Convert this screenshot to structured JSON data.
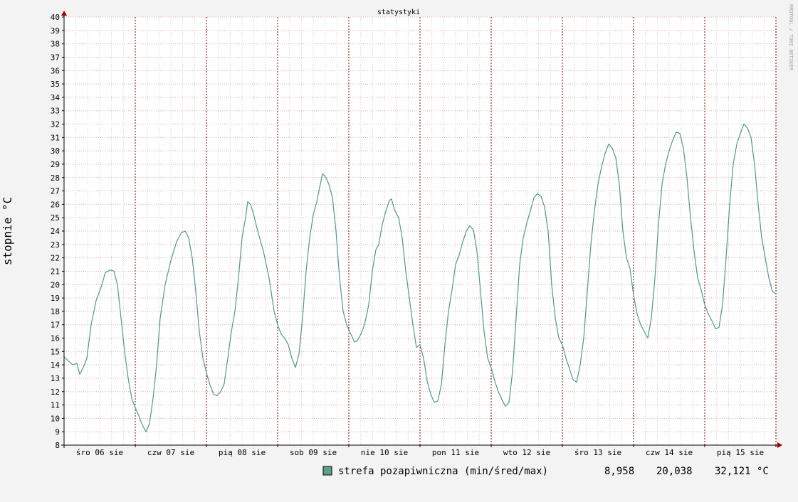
{
  "chart_data": {
    "type": "line",
    "title": "statystyki",
    "ylabel": "stopnie °C",
    "watermark": "RRDTOOL / TOBI OETIKER",
    "ylim": [
      8,
      40
    ],
    "yticks": [
      8,
      9,
      10,
      11,
      12,
      13,
      14,
      15,
      16,
      17,
      18,
      19,
      20,
      21,
      22,
      23,
      24,
      25,
      26,
      27,
      28,
      29,
      30,
      31,
      32,
      33,
      34,
      35,
      36,
      37,
      38,
      39,
      40
    ],
    "xlim": [
      0,
      10
    ],
    "categories": [
      "śro 06 sie",
      "czw 07 sie",
      "pią 08 sie",
      "sob 09 sie",
      "nie 10 sie",
      "pon 11 sie",
      "wto 12 sie",
      "śro 13 sie",
      "czw 14 sie",
      "pią 15 sie"
    ],
    "series": [
      {
        "name": "strefa pozapiwniczna",
        "color": "#4e9a88",
        "points": [
          [
            0.0,
            14.6
          ],
          [
            0.08,
            14.2
          ],
          [
            0.12,
            14.0
          ],
          [
            0.18,
            14.1
          ],
          [
            0.22,
            13.3
          ],
          [
            0.27,
            13.8
          ],
          [
            0.32,
            14.5
          ],
          [
            0.38,
            17.0
          ],
          [
            0.45,
            18.8
          ],
          [
            0.52,
            19.8
          ],
          [
            0.58,
            20.9
          ],
          [
            0.65,
            21.1
          ],
          [
            0.7,
            21.0
          ],
          [
            0.75,
            20.0
          ],
          [
            0.8,
            17.5
          ],
          [
            0.85,
            15.0
          ],
          [
            0.9,
            13.0
          ],
          [
            0.95,
            11.5
          ],
          [
            1.0,
            10.8
          ],
          [
            1.05,
            10.2
          ],
          [
            1.1,
            9.5
          ],
          [
            1.15,
            9.0
          ],
          [
            1.2,
            9.6
          ],
          [
            1.25,
            11.5
          ],
          [
            1.3,
            14.0
          ],
          [
            1.35,
            17.5
          ],
          [
            1.42,
            20.0
          ],
          [
            1.5,
            21.8
          ],
          [
            1.58,
            23.2
          ],
          [
            1.65,
            23.9
          ],
          [
            1.7,
            24.0
          ],
          [
            1.75,
            23.5
          ],
          [
            1.8,
            22.0
          ],
          [
            1.85,
            19.5
          ],
          [
            1.9,
            16.5
          ],
          [
            1.95,
            14.5
          ],
          [
            2.0,
            13.4
          ],
          [
            2.05,
            12.5
          ],
          [
            2.1,
            11.8
          ],
          [
            2.15,
            11.7
          ],
          [
            2.2,
            12.0
          ],
          [
            2.25,
            12.6
          ],
          [
            2.3,
            14.5
          ],
          [
            2.35,
            16.5
          ],
          [
            2.4,
            18.0
          ],
          [
            2.45,
            20.5
          ],
          [
            2.5,
            23.5
          ],
          [
            2.55,
            25.0
          ],
          [
            2.58,
            26.2
          ],
          [
            2.62,
            26.0
          ],
          [
            2.66,
            25.3
          ],
          [
            2.72,
            24.0
          ],
          [
            2.8,
            22.5
          ],
          [
            2.88,
            20.5
          ],
          [
            2.95,
            18.0
          ],
          [
            3.0,
            17.0
          ],
          [
            3.05,
            16.3
          ],
          [
            3.1,
            16.0
          ],
          [
            3.15,
            15.5
          ],
          [
            3.2,
            14.5
          ],
          [
            3.25,
            13.8
          ],
          [
            3.3,
            14.8
          ],
          [
            3.35,
            17.5
          ],
          [
            3.4,
            21.0
          ],
          [
            3.45,
            23.5
          ],
          [
            3.5,
            25.2
          ],
          [
            3.55,
            26.2
          ],
          [
            3.6,
            27.5
          ],
          [
            3.63,
            28.3
          ],
          [
            3.68,
            28.0
          ],
          [
            3.72,
            27.5
          ],
          [
            3.77,
            26.5
          ],
          [
            3.82,
            24.0
          ],
          [
            3.87,
            20.5
          ],
          [
            3.92,
            18.0
          ],
          [
            3.97,
            17.0
          ],
          [
            4.02,
            16.4
          ],
          [
            4.08,
            15.7
          ],
          [
            4.12,
            15.8
          ],
          [
            4.17,
            16.3
          ],
          [
            4.22,
            17.0
          ],
          [
            4.28,
            18.5
          ],
          [
            4.33,
            21.0
          ],
          [
            4.38,
            22.6
          ],
          [
            4.42,
            23.0
          ],
          [
            4.47,
            24.5
          ],
          [
            4.52,
            25.5
          ],
          [
            4.57,
            26.3
          ],
          [
            4.6,
            26.4
          ],
          [
            4.64,
            25.6
          ],
          [
            4.7,
            25.0
          ],
          [
            4.75,
            23.5
          ],
          [
            4.8,
            21.0
          ],
          [
            4.85,
            19.0
          ],
          [
            4.9,
            17.0
          ],
          [
            4.95,
            15.3
          ],
          [
            5.0,
            15.5
          ],
          [
            5.05,
            14.5
          ],
          [
            5.1,
            12.8
          ],
          [
            5.15,
            11.8
          ],
          [
            5.2,
            11.2
          ],
          [
            5.25,
            11.3
          ],
          [
            5.3,
            12.5
          ],
          [
            5.35,
            15.5
          ],
          [
            5.4,
            18.0
          ],
          [
            5.45,
            19.6
          ],
          [
            5.5,
            21.5
          ],
          [
            5.55,
            22.2
          ],
          [
            5.6,
            23.2
          ],
          [
            5.65,
            24.0
          ],
          [
            5.7,
            24.4
          ],
          [
            5.75,
            24.1
          ],
          [
            5.8,
            22.5
          ],
          [
            5.85,
            19.5
          ],
          [
            5.9,
            16.5
          ],
          [
            5.95,
            14.5
          ],
          [
            6.0,
            13.8
          ],
          [
            6.05,
            12.8
          ],
          [
            6.1,
            12.0
          ],
          [
            6.15,
            11.4
          ],
          [
            6.2,
            10.9
          ],
          [
            6.25,
            11.2
          ],
          [
            6.3,
            13.5
          ],
          [
            6.35,
            17.5
          ],
          [
            6.4,
            21.5
          ],
          [
            6.45,
            23.5
          ],
          [
            6.5,
            24.6
          ],
          [
            6.55,
            25.5
          ],
          [
            6.6,
            26.5
          ],
          [
            6.65,
            26.8
          ],
          [
            6.7,
            26.6
          ],
          [
            6.75,
            25.8
          ],
          [
            6.8,
            24.0
          ],
          [
            6.85,
            20.0
          ],
          [
            6.9,
            17.5
          ],
          [
            6.95,
            16.0
          ],
          [
            7.0,
            15.5
          ],
          [
            7.05,
            14.5
          ],
          [
            7.1,
            13.7
          ],
          [
            7.15,
            12.9
          ],
          [
            7.2,
            12.7
          ],
          [
            7.25,
            14.0
          ],
          [
            7.3,
            16.0
          ],
          [
            7.35,
            19.5
          ],
          [
            7.4,
            23.0
          ],
          [
            7.45,
            25.5
          ],
          [
            7.5,
            27.5
          ],
          [
            7.55,
            28.8
          ],
          [
            7.6,
            29.8
          ],
          [
            7.65,
            30.5
          ],
          [
            7.7,
            30.2
          ],
          [
            7.75,
            29.5
          ],
          [
            7.8,
            27.5
          ],
          [
            7.85,
            24.0
          ],
          [
            7.9,
            22.0
          ],
          [
            7.95,
            21.2
          ],
          [
            8.0,
            19.2
          ],
          [
            8.05,
            17.8
          ],
          [
            8.1,
            17.0
          ],
          [
            8.15,
            16.5
          ],
          [
            8.2,
            16.0
          ],
          [
            8.25,
            17.5
          ],
          [
            8.3,
            20.5
          ],
          [
            8.35,
            24.5
          ],
          [
            8.4,
            27.5
          ],
          [
            8.45,
            29.0
          ],
          [
            8.5,
            30.0
          ],
          [
            8.55,
            30.8
          ],
          [
            8.6,
            31.4
          ],
          [
            8.65,
            31.3
          ],
          [
            8.7,
            30.2
          ],
          [
            8.75,
            28.0
          ],
          [
            8.8,
            25.0
          ],
          [
            8.85,
            22.5
          ],
          [
            8.9,
            20.5
          ],
          [
            8.95,
            19.6
          ],
          [
            9.0,
            18.5
          ],
          [
            9.05,
            17.8
          ],
          [
            9.1,
            17.3
          ],
          [
            9.15,
            16.7
          ],
          [
            9.2,
            16.8
          ],
          [
            9.25,
            18.5
          ],
          [
            9.3,
            22.0
          ],
          [
            9.35,
            26.0
          ],
          [
            9.4,
            29.0
          ],
          [
            9.45,
            30.5
          ],
          [
            9.5,
            31.3
          ],
          [
            9.55,
            32.0
          ],
          [
            9.6,
            31.7
          ],
          [
            9.65,
            31.0
          ],
          [
            9.7,
            29.0
          ],
          [
            9.75,
            26.0
          ],
          [
            9.8,
            23.5
          ],
          [
            9.85,
            22.0
          ],
          [
            9.9,
            20.5
          ],
          [
            9.95,
            19.5
          ],
          [
            10.0,
            19.3
          ]
        ]
      }
    ],
    "legend": {
      "label": "strefa pozapiwniczna (min/śred/max)",
      "min": "8,958",
      "avg": "20,038",
      "max": "32,121 °C"
    },
    "grid": true,
    "colors": {
      "background": "#f3f3f3",
      "plot_bg": "#ffffff",
      "minor_grid": "#dcc8c8",
      "major_grid": "#e4a8a8",
      "day_divider": "#7a0000",
      "axis": "#000000",
      "arrow": "#9a0000",
      "line": "#4e9a88"
    }
  }
}
